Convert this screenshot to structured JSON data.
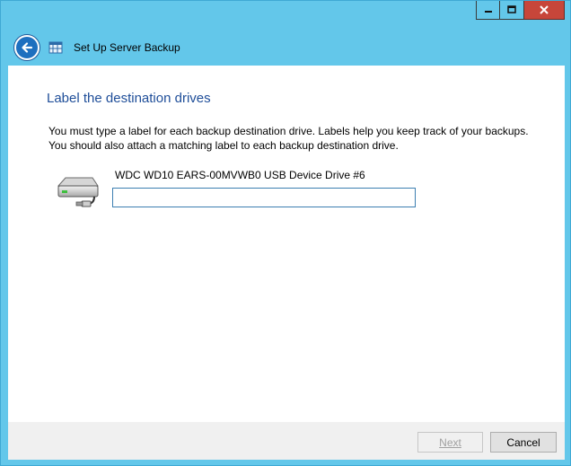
{
  "window": {
    "title": "Set Up Server Backup",
    "caption_buttons": [
      "minimize-icon",
      "maximize-icon",
      "close-icon"
    ],
    "accent_color": "#63c7ea"
  },
  "page": {
    "heading": "Label the destination drives",
    "description_line1": "You must type a label for each backup destination drive. Labels help you keep track of your backups.",
    "description_line2": "You should also attach a matching label to each backup destination drive."
  },
  "drive": {
    "icon": "usb-drive-icon",
    "name": "WDC WD10 EARS-00MVWB0 USB Device Drive #6",
    "label_value": ""
  },
  "footer": {
    "next_label": "Next",
    "cancel_label": "Cancel"
  }
}
